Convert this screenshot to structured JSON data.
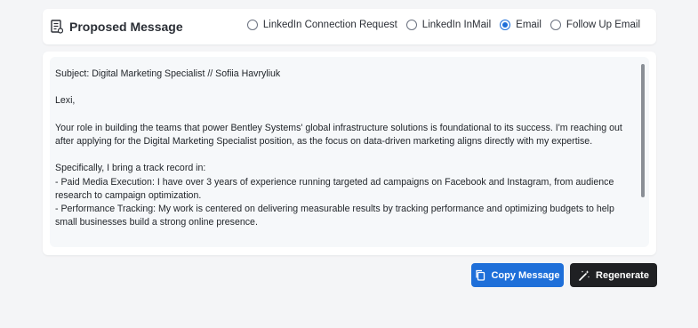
{
  "header": {
    "title": "Proposed Message",
    "options": [
      {
        "label": "LinkedIn Connection Request",
        "checked": false
      },
      {
        "label": "LinkedIn InMail",
        "checked": false
      },
      {
        "label": "Email",
        "checked": true
      },
      {
        "label": "Follow Up Email",
        "checked": false
      }
    ]
  },
  "message": {
    "text": "Subject: Digital Marketing Specialist // Sofiia Havryliuk\n\nLexi,\n\nYour role in building the teams that power Bentley Systems' global infrastructure solutions is foundational to its success. I'm reaching out after applying for the Digital Marketing Specialist position, as the focus on data-driven marketing aligns directly with my expertise.\n\nSpecifically, I bring a track record in:\n- Paid Media Execution: I have over 3 years of experience running targeted ad campaigns on Facebook and Instagram, from audience research to campaign optimization.\n- Performance Tracking: My work is centered on delivering measurable results by tracking performance and optimizing budgets to help small businesses build a strong online presence."
  },
  "actions": {
    "copy_label": "Copy Message",
    "regenerate_label": "Regenerate"
  },
  "colors": {
    "accent": "#1e6fd9",
    "dark_button": "#1f2023"
  },
  "icons": {
    "header": "document-list-icon",
    "copy": "copy-icon",
    "regenerate": "magic-wand-icon"
  }
}
